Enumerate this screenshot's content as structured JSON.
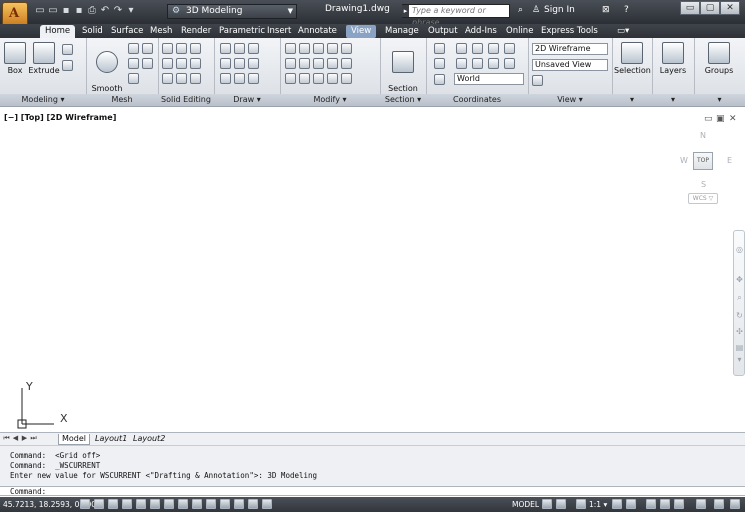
{
  "titlebar": {
    "workspace": "3D Modeling",
    "title": "Drawing1.dwg",
    "search_placeholder": "Type a keyword or phrase",
    "sign_in": "Sign In"
  },
  "tabs": [
    "Home",
    "Solid",
    "Surface",
    "Mesh",
    "Render",
    "Parametric",
    "Insert",
    "Annotate",
    "View",
    "Manage",
    "Output",
    "Add-Ins",
    "Online",
    "Express Tools"
  ],
  "ribbon": {
    "modeling": {
      "box": "Box",
      "extrude": "Extrude",
      "smooth_object": "Smooth\nObject",
      "title": "Modeling ▾"
    },
    "mesh_title": "Mesh",
    "solid_editing_title": "Solid Editing ▾",
    "draw_title": "Draw ▾",
    "modify_title": "Modify ▾",
    "section": {
      "plane": "Section\nPlane",
      "title": "Section ▾"
    },
    "coordinates": {
      "world": "World",
      "title": "Coordinates"
    },
    "view": {
      "visual_style": "2D Wireframe",
      "named_view": "Unsaved View",
      "title": "View ▾"
    },
    "selection": "Selection",
    "layers": "Layers",
    "groups": "Groups"
  },
  "viewport": {
    "label": "[−] [Top] [2D Wireframe]",
    "cube_face": "TOP",
    "compass": {
      "n": "N",
      "s": "S",
      "e": "E",
      "w": "W"
    },
    "wcs": "WCS ▽",
    "ucs_x": "X",
    "ucs_y": "Y"
  },
  "layout_tabs": [
    "Model",
    "Layout1",
    "Layout2"
  ],
  "command": {
    "lines": [
      "Command:  <Grid off>",
      "Command:  _WSCURRENT",
      "Enter new value for WSCURRENT <\"Drafting & Annotation\">: 3D Modeling"
    ],
    "prompt": "Command:"
  },
  "status": {
    "coords": "45.7213, 18.2593, 0.0000",
    "model": "MODEL",
    "scale": "1:1 ▾"
  }
}
